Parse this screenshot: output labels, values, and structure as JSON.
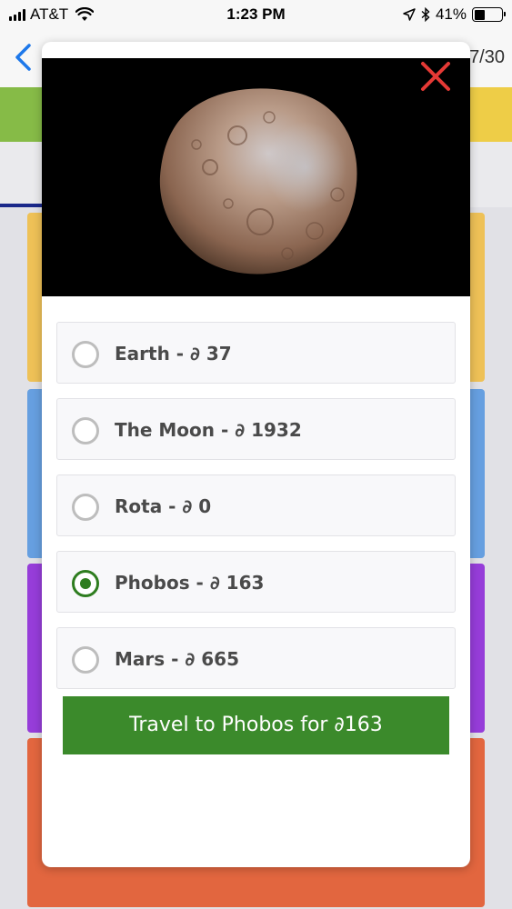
{
  "status_bar": {
    "carrier": "AT&T",
    "time": "1:23 PM",
    "battery_text": "41%",
    "battery_level": 0.41,
    "icons": [
      "signal-icon",
      "wifi-icon",
      "location-icon",
      "bluetooth-icon",
      "battery-icon"
    ]
  },
  "app": {
    "counter": "7/30",
    "colors": {
      "back_blue": "#1e7cf2",
      "strip_green": "#8bc24a",
      "strip_yellow": "#f6d44a",
      "tab_underline": "#1b2a8f",
      "card_colors": [
        "#f6c85a",
        "#6aa5e8",
        "#9b3fe0",
        "#ea6a42"
      ]
    }
  },
  "modal": {
    "image_subject": "phobos",
    "close_icon": "close-icon",
    "close_color": "#e53935",
    "options": [
      {
        "label": "Earth - ∂ 37",
        "selected": false
      },
      {
        "label": "The Moon - ∂ 1932",
        "selected": false
      },
      {
        "label": "Rota - ∂ 0",
        "selected": false
      },
      {
        "label": "Phobos - ∂ 163",
        "selected": true
      },
      {
        "label": "Mars - ∂ 665",
        "selected": false
      }
    ],
    "action_label": "Travel to Phobos for ∂163",
    "action_color": "#3b8a2b",
    "selected_color": "#2e7d1f"
  }
}
